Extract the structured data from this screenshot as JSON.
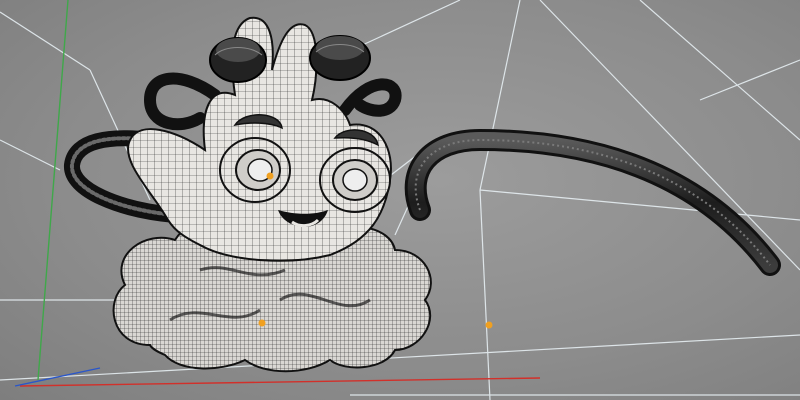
{
  "viewport": {
    "background": "#8f8f8f",
    "mesh_fill": "#e8e6e2",
    "mesh_wire": "#2a2a2a",
    "grid_line_color": "#e6eef2",
    "axis_colors": {
      "x": "#d2302a",
      "y": "#3fa84a",
      "z": "#2a56c9"
    },
    "pivot_color": "#f0a020"
  },
  "model": {
    "parts": [
      "hand-body",
      "left-finger",
      "right-finger",
      "left-eye",
      "right-eye",
      "mouth",
      "cloud",
      "left-arm-tube",
      "right-arm-tube",
      "tail-tube",
      "left-goggle",
      "right-goggle"
    ],
    "pivot_count": 3
  }
}
